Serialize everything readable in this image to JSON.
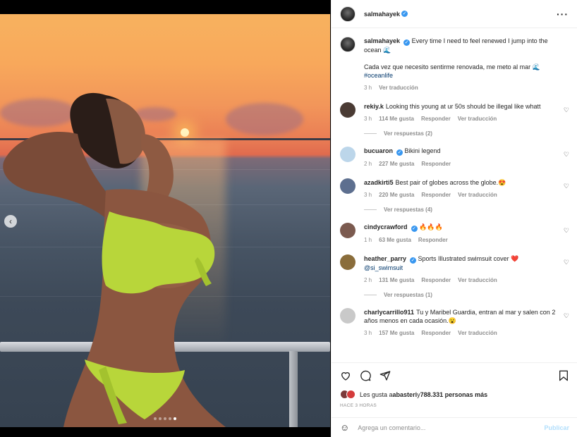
{
  "post": {
    "author": "salmahayek",
    "caption_line1": "Every time I need to feel renewed I jump into the ocean 🌊",
    "caption_line2": "Cada vez que necesito sentirme renovada, me meto al mar 🌊",
    "hashtag": "#oceanlife",
    "time": "3 h",
    "translate": "Ver traducción",
    "slide_total": 5,
    "slide_current": 5
  },
  "comments": [
    {
      "user": "rekiy.k",
      "verified": false,
      "text": "Looking this young at ur 50s should be illegal like whatt",
      "time": "3 h",
      "likes": "114 Me gusta",
      "reply": "Responder",
      "translate": "Ver traducción",
      "replies": "Ver respuestas (2)",
      "avatar_color": "#4a3b34"
    },
    {
      "user": "bucuaron",
      "verified": true,
      "text": "Bikini legend",
      "time": "2 h",
      "likes": "227 Me gusta",
      "reply": "Responder",
      "translate": "",
      "replies": "",
      "avatar_color": "#bcd6ea"
    },
    {
      "user": "azadkirti5",
      "verified": false,
      "text": "Best pair of globes across the globe.😍",
      "time": "3 h",
      "likes": "220 Me gusta",
      "reply": "Responder",
      "translate": "Ver traducción",
      "replies": "Ver respuestas (4)",
      "avatar_color": "#5d6f8f"
    },
    {
      "user": "cindycrawford",
      "verified": true,
      "text": "🔥🔥🔥",
      "time": "1 h",
      "likes": "63 Me gusta",
      "reply": "Responder",
      "translate": "",
      "replies": "",
      "avatar_color": "#7b5a4f"
    },
    {
      "user": "heather_parry",
      "verified": true,
      "text": "Sports Illustrated swimsuit cover ❤️",
      "mention": "@si_swimsuit",
      "time": "2 h",
      "likes": "131 Me gusta",
      "reply": "Responder",
      "translate": "Ver traducción",
      "replies": "Ver respuestas (1)",
      "avatar_color": "#8a6d3b"
    },
    {
      "user": "charlycarrillo911",
      "verified": false,
      "text": "Tu y Maribel Guardia, entran al mar y salen con 2 años menos en cada ocasión.😮",
      "time": "3 h",
      "likes": "157 Me gusta",
      "reply": "Responder",
      "translate": "Ver traducción",
      "replies": "",
      "avatar_color": "#c9c9c9"
    }
  ],
  "likes": {
    "prefix": "Les gusta a ",
    "user": "abasteri",
    "middle": " y ",
    "count": "788.331 personas más",
    "ago": "HACE 3 HORAS"
  },
  "composer": {
    "placeholder": "Agrega un comentario...",
    "post_label": "Publicar"
  },
  "colors": {
    "link": "#00376b",
    "verified": "#3897f0",
    "post_disabled": "#b2dffc",
    "heart_red": "#ed4956"
  },
  "icons": [
    "more-options-icon",
    "heart-icon",
    "comment-icon",
    "share-icon",
    "bookmark-icon",
    "emoji-icon",
    "chevron-left-icon"
  ]
}
